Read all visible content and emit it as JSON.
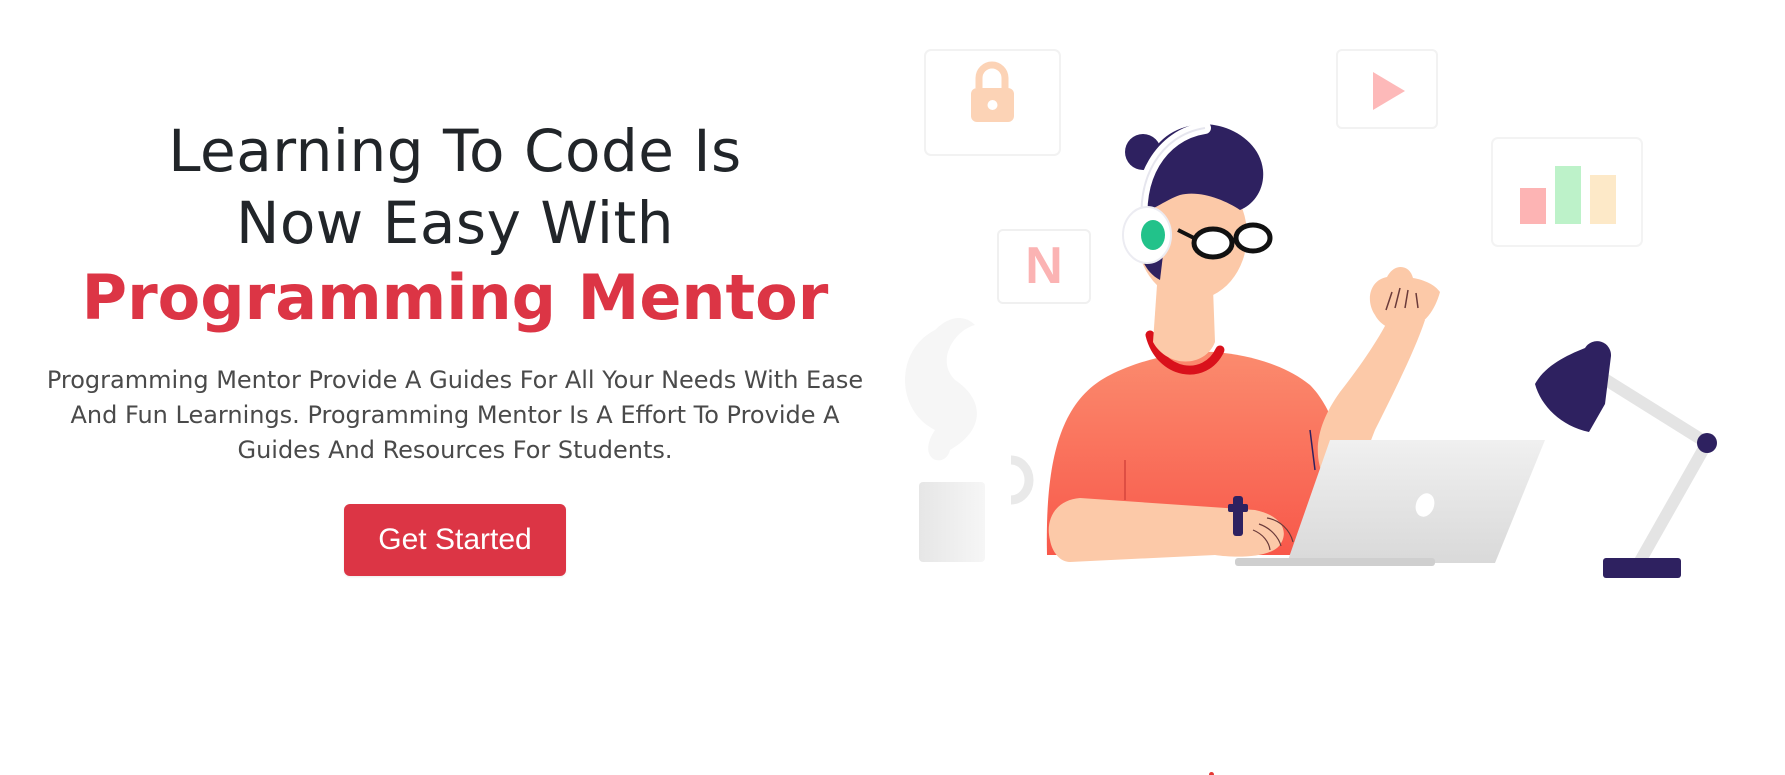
{
  "hero": {
    "headline_line1": "Learning To Code Is",
    "headline_line2": "Now Easy With",
    "headline_accent": "Programming Mentor",
    "description": "Programming Mentor Provide A Guides For All Your Needs With Ease And Fun Learnings. Programming Mentor Is A Effort To Provide A Guides And Resources For Students.",
    "cta_label": "Get Started"
  },
  "illustration": {
    "badge_letter": "N"
  },
  "colors": {
    "accent": "#dc3545",
    "text": "#212529",
    "shirt": "#fa6a52",
    "hair": "#2e2160",
    "skin": "#fcc9a8"
  }
}
